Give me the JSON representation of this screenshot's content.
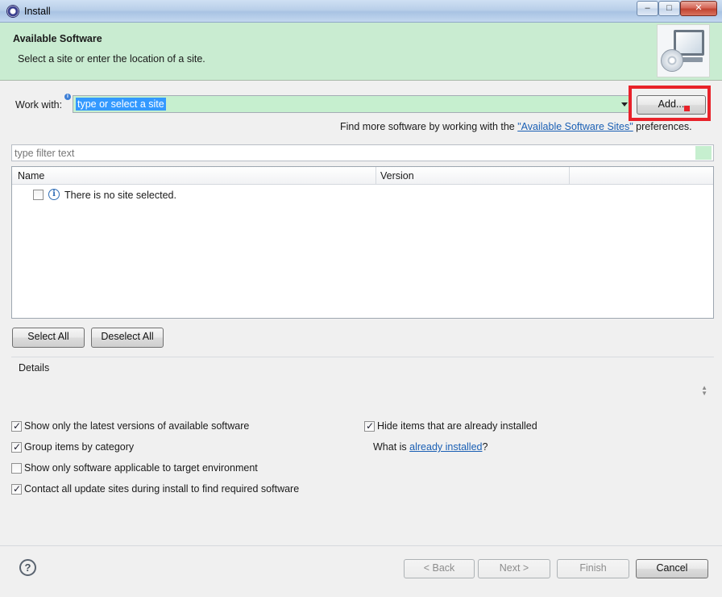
{
  "window": {
    "title": "Install"
  },
  "banner": {
    "title": "Available Software",
    "subtitle": "Select a site or enter the location of a site."
  },
  "work_with": {
    "label": "Work with:",
    "combo_value": "type or select a site",
    "add_button": "Add..."
  },
  "more_software": {
    "prefix": "Find more software by working with the ",
    "link": "\"Available Software Sites\"",
    "suffix": " preferences."
  },
  "filter": {
    "placeholder": "type filter text"
  },
  "table": {
    "columns": [
      "Name",
      "Version"
    ],
    "rows": [
      {
        "text": "There is no site selected.",
        "checked": false
      }
    ]
  },
  "buttons": {
    "select_all": "Select All",
    "deselect_all": "Deselect All"
  },
  "details": {
    "label": "Details"
  },
  "options": {
    "latest_versions": {
      "label": "Show only the latest versions of available software",
      "checked": true
    },
    "group_by_category": {
      "label": "Group items by category",
      "checked": true
    },
    "target_environment": {
      "label": "Show only software applicable to target environment",
      "checked": false
    },
    "contact_update_sites": {
      "label": "Contact all update sites during install to find required software",
      "checked": true
    },
    "hide_installed": {
      "label": "Hide items that are already installed",
      "checked": true
    },
    "what_is_prefix": "What is ",
    "what_is_link": "already installed",
    "what_is_suffix": "?"
  },
  "footer": {
    "back": "< Back",
    "next": "Next >",
    "finish": "Finish",
    "cancel": "Cancel"
  },
  "colors": {
    "banner_bg": "#c9ecd1",
    "selection": "#3399ff",
    "highlight": "#e8222a",
    "link": "#1a5fb4"
  }
}
